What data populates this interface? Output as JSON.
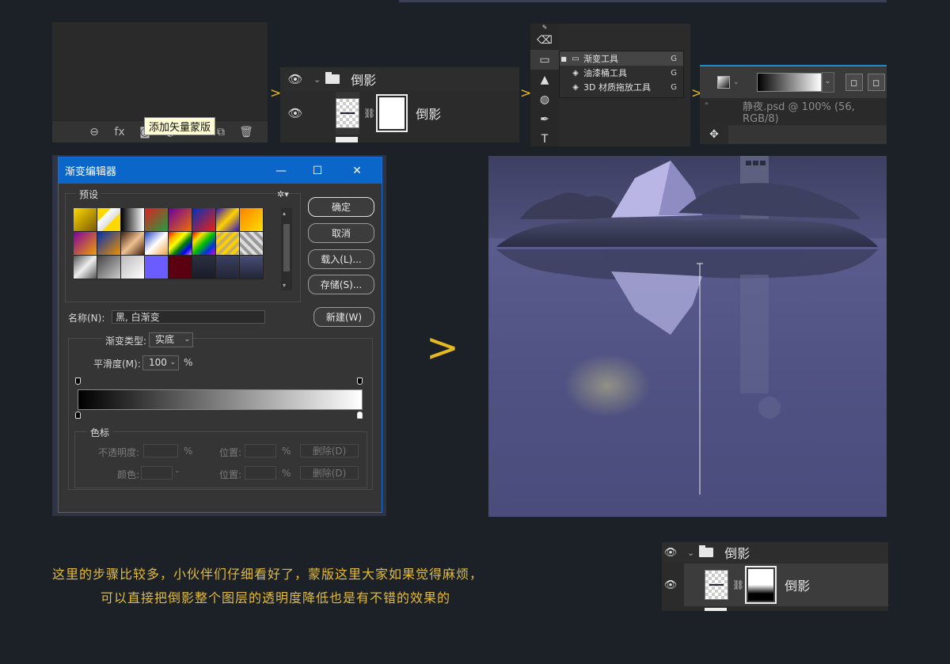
{
  "layers_footer": {
    "tooltip": "添加矢量蒙版",
    "icons": [
      "link-icon",
      "fx-icon",
      "mask-icon",
      "adjustment-icon",
      "folder-icon",
      "new-layer-icon",
      "trash-icon"
    ],
    "fx_label": "fx"
  },
  "layers_panel_top": {
    "group_name": "倒影",
    "layer_name": "倒影"
  },
  "tool_flyout": {
    "items": [
      {
        "label": "渐变工具",
        "key": "G"
      },
      {
        "label": "油漆桶工具",
        "key": "G"
      },
      {
        "label": "3D 材质拖放工具",
        "key": "G"
      }
    ]
  },
  "options_bar": {
    "doc_tab": "静夜.psd @ 100% (56, RGB/8)"
  },
  "gradient_editor": {
    "title": "渐变编辑器",
    "presets_label": "预设",
    "buttons": {
      "ok": "确定",
      "cancel": "取消",
      "load": "载入(L)...",
      "save": "存储(S)...",
      "new": "新建(W)"
    },
    "name_label": "名称(N):",
    "name_value": "黑, 白渐变",
    "type_label": "渐变类型:",
    "type_value": "实底",
    "smooth_label": "平滑度(M):",
    "smooth_value": "100",
    "smooth_unit": "%",
    "stops_label": "色标",
    "opacity_label": "不透明度:",
    "color_label": "颜色:",
    "location_label": "位置:",
    "percent": "%",
    "delete_label": "删除(D)"
  },
  "arrow_glyph": ">",
  "layers_panel_bottom": {
    "group_name": "倒影",
    "layer_name": "倒影"
  },
  "caption": {
    "line1": "这里的步骤比较多，小伙伴们仔细看好了，蒙版这里大家如果觉得麻烦，",
    "line2": "可以直接把倒影整个图层的透明度降低也是有不错的效果的"
  },
  "colors": {
    "accent": "#e6b91e",
    "dialog_title": "#0a66c8",
    "background": "#1c2127"
  }
}
